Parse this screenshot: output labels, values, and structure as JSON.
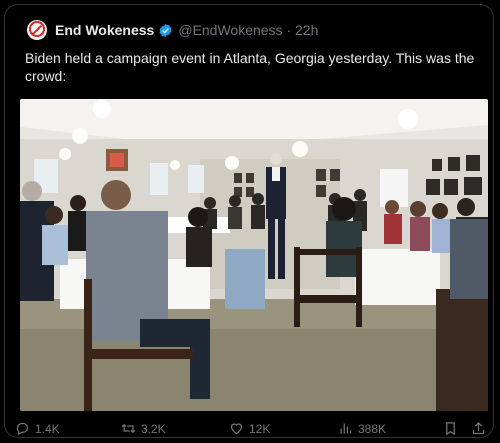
{
  "post": {
    "author_name": "End Wokeness",
    "handle_line": "@EndWokeness · 22h",
    "text": "Biden held a campaign event in Atlanta, Georgia yesterday. This was the crowd:",
    "verified": true
  },
  "actions": {
    "replies": "1.4K",
    "retweets": "3.2K",
    "likes": "12K",
    "views": "388K"
  },
  "colors": {
    "background": "#000000",
    "text_primary": "#e7e9ea",
    "text_secondary": "#71767b",
    "verified_blue": "#1d9bf0"
  },
  "icons": [
    "reply-icon",
    "retweet-icon",
    "like-icon",
    "views-icon",
    "bookmark-icon",
    "share-icon",
    "verified-badge-icon"
  ]
}
